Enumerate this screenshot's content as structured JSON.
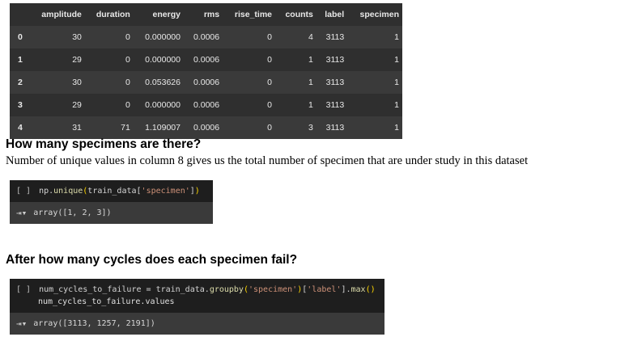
{
  "table": {
    "columns": [
      "",
      "amplitude",
      "duration",
      "energy",
      "rms",
      "rise_time",
      "counts",
      "label",
      "specimen"
    ],
    "rows": [
      {
        "idx": "0",
        "amplitude": "30",
        "duration": "0",
        "energy": "0.000000",
        "rms": "0.0006",
        "rise_time": "0",
        "counts": "4",
        "label": "3113",
        "specimen": "1"
      },
      {
        "idx": "1",
        "amplitude": "29",
        "duration": "0",
        "energy": "0.000000",
        "rms": "0.0006",
        "rise_time": "0",
        "counts": "1",
        "label": "3113",
        "specimen": "1"
      },
      {
        "idx": "2",
        "amplitude": "30",
        "duration": "0",
        "energy": "0.053626",
        "rms": "0.0006",
        "rise_time": "0",
        "counts": "1",
        "label": "3113",
        "specimen": "1"
      },
      {
        "idx": "3",
        "amplitude": "29",
        "duration": "0",
        "energy": "0.000000",
        "rms": "0.0006",
        "rise_time": "0",
        "counts": "1",
        "label": "3113",
        "specimen": "1"
      },
      {
        "idx": "4",
        "amplitude": "31",
        "duration": "71",
        "energy": "1.109007",
        "rms": "0.0006",
        "rise_time": "0",
        "counts": "3",
        "label": "3113",
        "specimen": "1"
      }
    ]
  },
  "section1": {
    "heading": "How many specimens are there?",
    "paragraph": "Number of unique values in  column 8 gives us the total number of specimen that are under study in this dataset",
    "cell": {
      "run_label": "[ ]",
      "code_parts": [
        "np",
        ".",
        "unique",
        "(",
        "train_data",
        "[",
        "'specimen'",
        "]",
        ")"
      ],
      "output_icon": "output-toggle-icon",
      "output": "array([1, 2, 3])"
    }
  },
  "section2": {
    "heading": "After how many cycles does each specimen fail?",
    "cell": {
      "run_label": "[ ]",
      "line1_parts": [
        "num_cycles_to_failure",
        " = ",
        "train_data",
        ".",
        "groupby",
        "(",
        "'specimen'",
        ")",
        "[",
        "'label'",
        "]",
        ".",
        "max",
        "()"
      ],
      "line2": "num_cycles_to_failure.values",
      "output_icon": "output-toggle-icon",
      "output": "array([3113, 1257, 2191])"
    }
  },
  "colors": {
    "table_bg": "#383838",
    "code_bg": "#1e1e1e",
    "string": "#ce9178",
    "function": "#dcdcaa"
  }
}
